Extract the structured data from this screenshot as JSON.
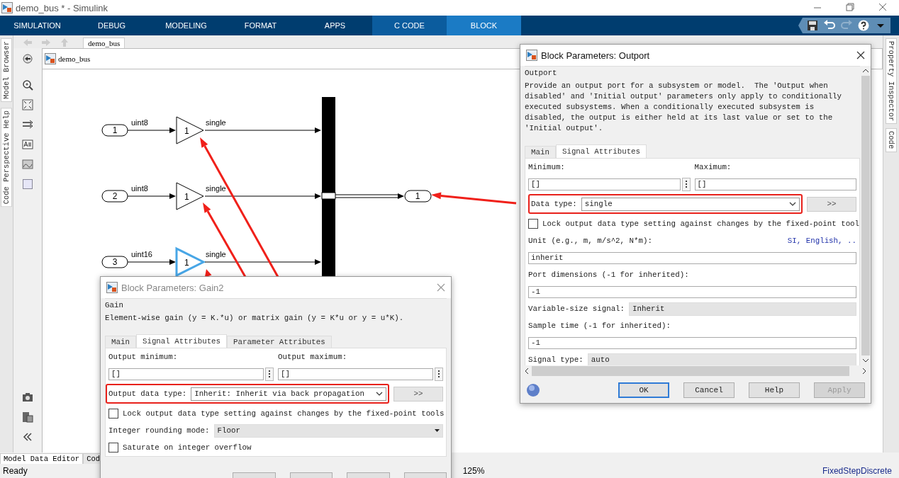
{
  "window": {
    "title": "demo_bus * - Simulink"
  },
  "ribbon": {
    "tabs": [
      {
        "label": "SIMULATION",
        "selected": false,
        "kind": "standard"
      },
      {
        "label": "DEBUG",
        "selected": false,
        "kind": "standard"
      },
      {
        "label": "MODELING",
        "selected": false,
        "kind": "standard"
      },
      {
        "label": "FORMAT",
        "selected": false,
        "kind": "standard"
      },
      {
        "label": "APPS",
        "selected": false,
        "kind": "standard"
      },
      {
        "label": "C CODE",
        "selected": false,
        "kind": "contextual"
      },
      {
        "label": "BLOCK",
        "selected": true,
        "kind": "contextual"
      }
    ]
  },
  "left_panel_tabs": [
    {
      "label": "Model Browser"
    },
    {
      "label": "Code Perspective Help"
    }
  ],
  "breadcrumb": {
    "tab": "demo_bus"
  },
  "address_bar": {
    "path": "demo_bus"
  },
  "diagram": {
    "inports": [
      {
        "label": "1",
        "signal": "uint8"
      },
      {
        "label": "2",
        "signal": "uint8"
      },
      {
        "label": "3",
        "signal": "uint16"
      }
    ],
    "gains": [
      {
        "label": "1",
        "output": "single",
        "selected": false
      },
      {
        "label": "1",
        "output": "single",
        "selected": false
      },
      {
        "label": "1",
        "output": "single",
        "selected": true
      }
    ],
    "outport": {
      "label": "1"
    }
  },
  "right_panel_tabs": [
    {
      "label": "Property Inspector"
    },
    {
      "label": "Code"
    }
  ],
  "outport_dialog": {
    "title": "Block Parameters: Outport",
    "active": true,
    "group": "Outport",
    "description": "Provide an output port for a subsystem or model.  The 'Output when disabled' and 'Initial output' parameters only apply to conditionally executed subsystems. When a conditionally executed subsystem is disabled, the output is either held at its last value or set to the 'Initial output'.",
    "tabs": [
      {
        "label": "Main",
        "selected": false
      },
      {
        "label": "Signal Attributes",
        "selected": true
      }
    ],
    "minimum": {
      "label": "Minimum:",
      "value": "[]"
    },
    "maximum": {
      "label": "Maximum:",
      "value": "[]"
    },
    "data_type": {
      "label": "Data type:",
      "value": "single",
      "more": ">>"
    },
    "lock": {
      "label": "Lock output data type setting against changes by the fixed-point tool",
      "checked": false
    },
    "unit": {
      "label": "Unit (e.g., m, m/s^2, N*m):",
      "link": "SI, English, ..",
      "value": "inherit"
    },
    "port_dimensions": {
      "label": "Port dimensions (-1 for inherited):",
      "value": "-1"
    },
    "variable_size": {
      "label": "Variable-size signal:",
      "value": "Inherit"
    },
    "sample_time": {
      "label": "Sample time (-1 for inherited):",
      "value": "-1"
    },
    "signal_type": {
      "label": "Signal type:",
      "value": "auto"
    },
    "buttons": [
      {
        "label": "OK",
        "default": true,
        "disabled": false
      },
      {
        "label": "Cancel",
        "default": false,
        "disabled": false
      },
      {
        "label": "Help",
        "default": false,
        "disabled": false
      },
      {
        "label": "Apply",
        "default": false,
        "disabled": true
      }
    ]
  },
  "gain_dialog": {
    "title": "Block Parameters: Gain2",
    "active": false,
    "group": "Gain",
    "description": "Element-wise gain (y = K.*u) or matrix gain (y = K*u or y = u*K).",
    "tabs": [
      {
        "label": "Main",
        "selected": false
      },
      {
        "label": "Signal Attributes",
        "selected": true
      },
      {
        "label": "Parameter Attributes",
        "selected": false
      }
    ],
    "output_minimum": {
      "label": "Output minimum:",
      "value": "[]"
    },
    "output_maximum": {
      "label": "Output maximum:",
      "value": "[]"
    },
    "output_data_type": {
      "label": "Output data type:",
      "value": "Inherit: Inherit via back propagation",
      "more": ">>"
    },
    "lock": {
      "label": "Lock output data type setting against changes by the fixed-point tools",
      "checked": false
    },
    "rounding": {
      "label": "Integer rounding mode:",
      "value": "Floor"
    },
    "saturate": {
      "label": "Saturate on integer overflow",
      "checked": false
    }
  },
  "bottom_tabs": [
    {
      "label": "Model Data Editor",
      "selected": true
    },
    {
      "label": "Cod",
      "selected": false
    }
  ],
  "status_bar": {
    "status": "Ready",
    "zoom": "125%",
    "solver": "FixedStepDiscrete"
  }
}
